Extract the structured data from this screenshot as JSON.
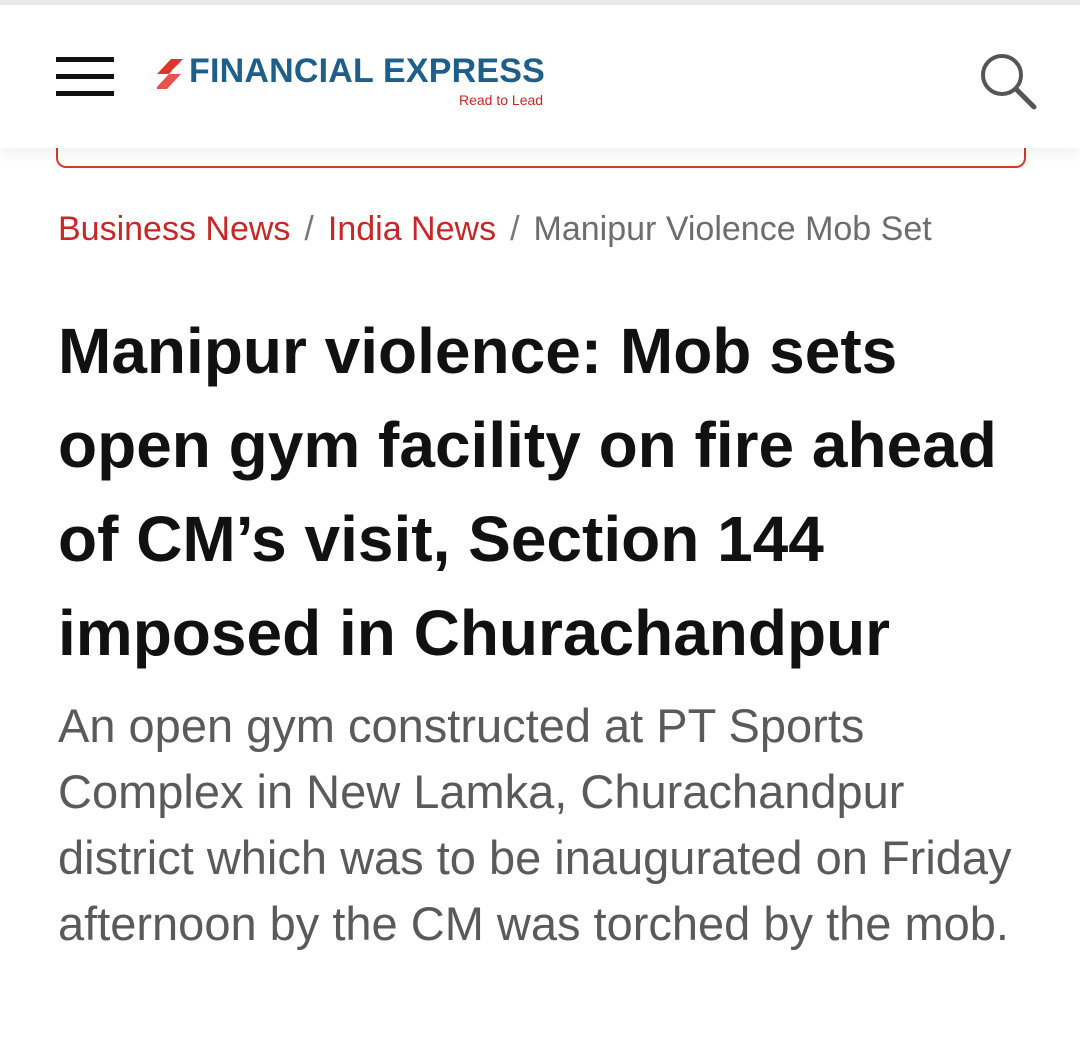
{
  "header": {
    "logo_name": "FINANCIAL EXPRESS",
    "logo_tagline": "Read to Lead",
    "menu_icon": "hamburger-menu-icon",
    "search_icon": "search-icon",
    "brand_blue": "#1d5f8a",
    "brand_red": "#c62828"
  },
  "breadcrumb": {
    "items": [
      "Business News",
      "India News"
    ],
    "separator": "/",
    "current": "Manipur Violence Mob Set"
  },
  "article": {
    "headline": "Manipur violence: Mob sets open gym facility on fire ahead of CM’s visit, Section 144 imposed in Churachandpur",
    "summary": "An open gym constructed at PT Sports Complex in New Lamka, Churachandpur district which was to be inaugurated on Friday afternoon by the CM was torched by the mob."
  }
}
